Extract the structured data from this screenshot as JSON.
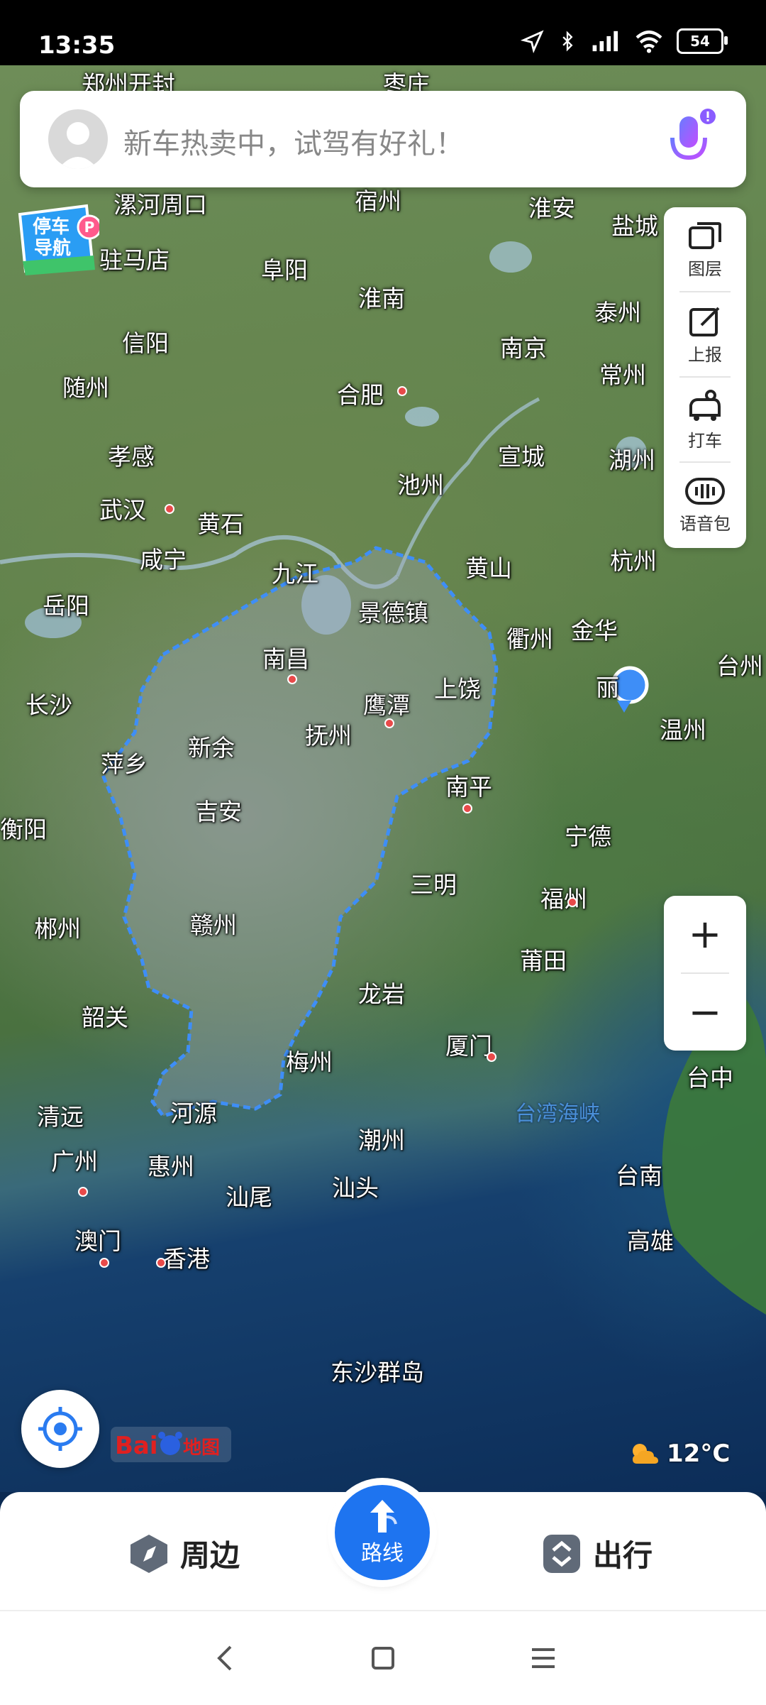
{
  "status_bar": {
    "time": "13:35",
    "battery": "54"
  },
  "search": {
    "placeholder": "新车热卖中，试驾有好礼！"
  },
  "parking_badge": {
    "line1": "停车",
    "line2": "导航"
  },
  "toolbar": {
    "layers_label": "图层",
    "report_label": "上报",
    "taxi_label": "打车",
    "voice_label": "语音包"
  },
  "zoom": {
    "in_label": "+",
    "out_label": "−"
  },
  "map": {
    "cities": [
      "郑州开封",
      "枣庄",
      "漯河周口",
      "宿州",
      "淮安",
      "盐城",
      "驻马店",
      "阜阳",
      "淮南",
      "泰州",
      "信阳",
      "南京",
      "常州",
      "随州",
      "合肥",
      "孝感",
      "宣城",
      "池州",
      "湖州",
      "武汉",
      "黄石",
      "咸宁",
      "九江",
      "黄山",
      "杭州",
      "岳阳",
      "景德镇",
      "衢州",
      "金华",
      "南昌",
      "上饶",
      "台州",
      "鹰潭",
      "丽",
      "长沙",
      "抚州",
      "温州",
      "萍乡",
      "新余",
      "南平",
      "吉安",
      "衡阳",
      "宁德",
      "三明",
      "福州",
      "郴州",
      "赣州",
      "莆田",
      "龙岩",
      "韶关",
      "梅州",
      "厦门",
      "台中",
      "清远",
      "河源",
      "潮州",
      "广州",
      "惠州",
      "台南",
      "汕尾",
      "汕头",
      "高雄",
      "澳门",
      "香港",
      "东沙群岛"
    ],
    "sea_label": "台湾海峡",
    "logo": "Bai地图",
    "weather_temp": "12°C"
  },
  "bottom_bar": {
    "nearby_label": "周边",
    "route_label": "路线",
    "travel_label": "出行"
  }
}
